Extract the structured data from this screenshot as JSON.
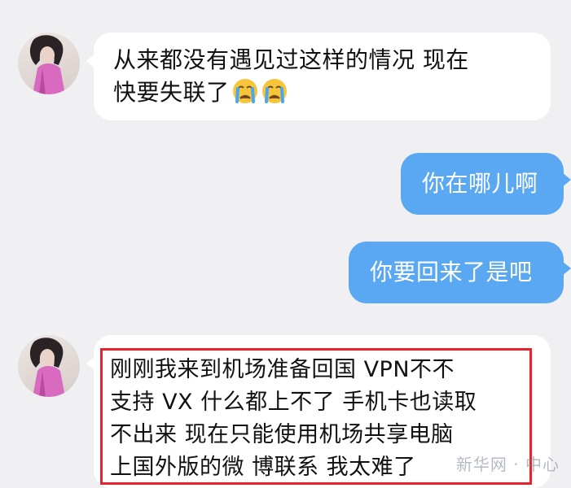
{
  "messages": [
    {
      "sender": "contact",
      "lines": [
        "从来都没有遇见过这样的情况 现在",
        "快要失联了"
      ],
      "emoji": [
        "crying-face",
        "crying-face"
      ]
    },
    {
      "sender": "me",
      "text": "你在哪儿啊"
    },
    {
      "sender": "me",
      "text": "你要回来了是吧"
    },
    {
      "sender": "contact",
      "lines": [
        "刚刚我来到机场准备回国 VPN不不",
        "支持 VX 什么都上不了 手机卡也读取",
        "不出来 现在只能使用机场共享电脑",
        "上国外版的微 博联系 我太难了"
      ],
      "highlighted": true
    }
  ],
  "watermark": "新华网 · 中心",
  "colors": {
    "background": "#f0f0f3",
    "incoming_bubble": "#ffffff",
    "outgoing_bubble": "#5aa8f2",
    "highlight_border": "#e8232c"
  }
}
